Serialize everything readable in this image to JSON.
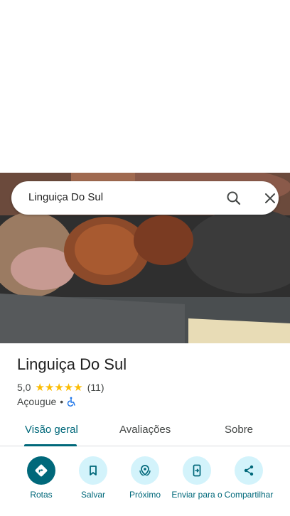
{
  "search": {
    "query": "Linguiça Do Sul"
  },
  "place": {
    "name": "Linguiça Do Sul",
    "rating": "5,0",
    "stars": "★★★★★",
    "review_count": "(11)",
    "category": "Açougue",
    "separator": "•"
  },
  "tabs": [
    {
      "label": "Visão geral",
      "active": true
    },
    {
      "label": "Avaliações",
      "active": false
    },
    {
      "label": "Sobre",
      "active": false
    }
  ],
  "actions": [
    {
      "label": "Rotas",
      "icon": "directions-icon"
    },
    {
      "label": "Salvar",
      "icon": "bookmark-icon"
    },
    {
      "label": "Próximo",
      "icon": "nearby-icon"
    },
    {
      "label": "Enviar para o",
      "icon": "send-to-phone-icon"
    },
    {
      "label": "Compartilhar",
      "icon": "share-icon"
    }
  ],
  "colors": {
    "accent": "#00687a",
    "accent_light": "#d3f3fb",
    "star": "#fbbc04",
    "text": "#1f1f1f",
    "subtext": "#444746"
  }
}
